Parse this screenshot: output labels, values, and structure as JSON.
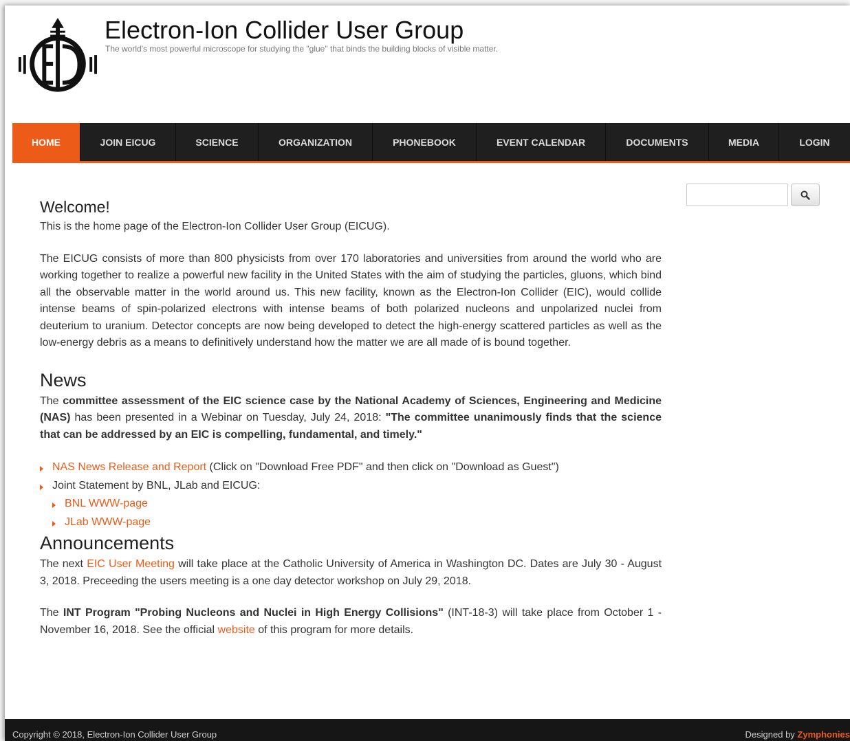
{
  "header": {
    "title": "Electron-Ion Collider User Group",
    "tagline": "The world's most powerful microscope for studying the \"glue\" that binds the building blocks of visible matter."
  },
  "nav": [
    {
      "label": "HOME",
      "active": true
    },
    {
      "label": "JOIN EICUG"
    },
    {
      "label": "SCIENCE"
    },
    {
      "label": "ORGANIZATION"
    },
    {
      "label": "PHONEBOOK"
    },
    {
      "label": "EVENT CALENDAR"
    },
    {
      "label": "DOCUMENTS"
    },
    {
      "label": "MEDIA"
    },
    {
      "label": "LOGIN"
    }
  ],
  "search": {
    "placeholder": "",
    "value": ""
  },
  "welcome": {
    "heading": "Welcome!",
    "intro": "This is the home page of the Electron-Ion Collider User Group (EICUG).",
    "body": "The EICUG consists of more than 800 physicists from over 170 laboratories and universities from around the world who are working together to realize a powerful new facility in the United States with the aim of studying the particles, gluons, which bind all the observable matter in the world around us. This new facility, known as the Electron-Ion Collider (EIC), would collide intense beams of spin-polarized electrons with intense beams of both polarized nucleons and unpolarized nuclei from deuterium to uranium. Detector concepts are now being developed to detect the high-energy scattered particles as well as the low-energy debris as a means to definitively understand how the matter we are all made of is bound together."
  },
  "news": {
    "heading": "News",
    "p_start": "The ",
    "p_bold1": "committee assessment of the EIC science case by the National Academy of Sciences, Engineering and Medicine (NAS)",
    "p_mid": " has been presented in a Webinar on Tuesday, July 24, 2018: ",
    "p_bold2": "\"The committee unanimously finds that the science that can be addressed by an EIC is compelling, fundamental, and timely.\"",
    "item1_link": "NAS News Release and Report",
    "item1_text": " (Click on \"Download Free PDF\" and then click on \"Download as Guest\")",
    "item2_text": "Joint Statement by BNL, JLab and EICUG:",
    "sub1_link": "BNL WWW-page",
    "sub2_link": "JLab WWW-page"
  },
  "announcements": {
    "heading": "Announcements",
    "p1_start": "The next ",
    "p1_link": "EIC User Meeting",
    "p1_end": " will take place at the Catholic University of America in Washington DC. Dates are July 30 - August 3, 2018. Preceeding the users meeting is a one day detector workshop on July 29, 2018.",
    "p2_start": "The ",
    "p2_bold": "INT Program \"Probing Nucleons and Nuclei in High Energy Collisions\"",
    "p2_mid": " (INT-18-3) will take place from October 1 - November 16, 2018. See the official ",
    "p2_link": "website",
    "p2_end": " of this program for more details."
  },
  "footer": {
    "copyright": "Copyright © 2018, Electron-Ion Collider User Group",
    "designed_by": "Designed by ",
    "designer": "Zymphonies"
  },
  "icons": {
    "search": "search-icon",
    "bullet": "bullet-arrow-icon",
    "logo": "eic-logo"
  },
  "colors": {
    "accent": "#ec5c18",
    "nav_bg": "#1f1f1f",
    "footer_bg": "#161616"
  }
}
